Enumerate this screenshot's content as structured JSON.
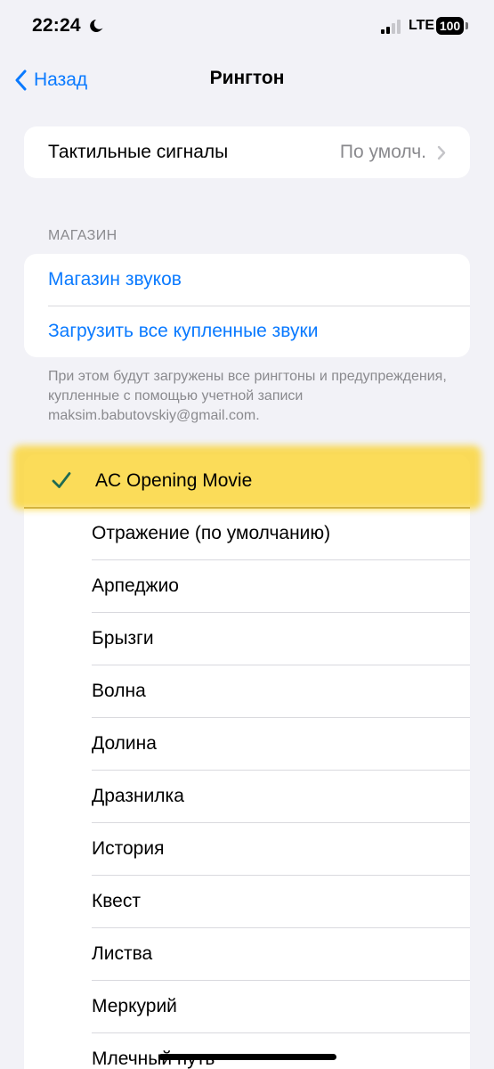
{
  "status_bar": {
    "time": "22:24",
    "network": "LTE",
    "battery": "100"
  },
  "nav": {
    "back_label": "Назад",
    "title": "Рингтон"
  },
  "haptics": {
    "label": "Тактильные сигналы",
    "value": "По умолч."
  },
  "store": {
    "header": "МАГАЗИН",
    "items": [
      {
        "label": "Магазин звуков"
      },
      {
        "label": "Загрузить все купленные звуки"
      }
    ],
    "footer": "При этом будут загружены все рингтоны и предупреждения, купленные с помощью учетной записи maksim.babutovskiy@gmail.com."
  },
  "ringtones": {
    "selected": "AC Opening Movie",
    "items": [
      {
        "label": "Отражение (по умолчанию)"
      },
      {
        "label": "Арпеджио"
      },
      {
        "label": "Брызги"
      },
      {
        "label": "Волна"
      },
      {
        "label": "Долина"
      },
      {
        "label": "Дразнилка"
      },
      {
        "label": "История"
      },
      {
        "label": "Квест"
      },
      {
        "label": "Листва"
      },
      {
        "label": "Меркурий"
      },
      {
        "label": "Млечный путь"
      }
    ]
  },
  "colors": {
    "accent": "#0a7aff",
    "check": "#1f6b52",
    "highlight": "#fad63c",
    "background": "#f2f2f7"
  }
}
